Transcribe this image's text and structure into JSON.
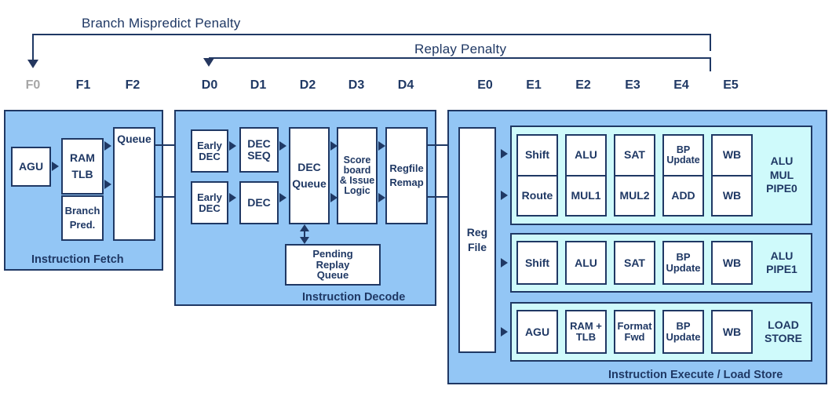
{
  "diagram": {
    "title": "CPU Pipeline Stage Diagram",
    "colors": {
      "outline": "#1F3864",
      "section_fill": "#93C6F5",
      "pipe_fill": "#CFFAFB",
      "unit_fill": "#FFFFFF",
      "dim_label": "#A6A6A6"
    }
  },
  "annotations": [
    {
      "label": "Branch Mispredict Penalty",
      "from_stage": "F0",
      "to_stage": "E5"
    },
    {
      "label": "Replay Penalty",
      "from_stage": "D0",
      "to_stage": "E5"
    }
  ],
  "stages": [
    {
      "id": "F0",
      "label": "F0",
      "dim": true
    },
    {
      "id": "F1",
      "label": "F1",
      "dim": false
    },
    {
      "id": "F2",
      "label": "F2",
      "dim": false
    },
    {
      "id": "D0",
      "label": "D0",
      "dim": false
    },
    {
      "id": "D1",
      "label": "D1",
      "dim": false
    },
    {
      "id": "D2",
      "label": "D2",
      "dim": false
    },
    {
      "id": "D3",
      "label": "D3",
      "dim": false
    },
    {
      "id": "D4",
      "label": "D4",
      "dim": false
    },
    {
      "id": "E0",
      "label": "E0",
      "dim": false
    },
    {
      "id": "E1",
      "label": "E1",
      "dim": false
    },
    {
      "id": "E2",
      "label": "E2",
      "dim": false
    },
    {
      "id": "E3",
      "label": "E3",
      "dim": false
    },
    {
      "id": "E4",
      "label": "E4",
      "dim": false
    },
    {
      "id": "E5",
      "label": "E5",
      "dim": false
    }
  ],
  "sections": {
    "fetch": {
      "title": "Instruction Fetch",
      "units": {
        "agu": "AGU",
        "ram_tlb_line1": "RAM",
        "ram_tlb_line2": "TLB",
        "branch_pred_line1": "Branch",
        "branch_pred_line2": "Pred.",
        "queue": "Queue"
      }
    },
    "decode": {
      "title": "Instruction Decode",
      "units": {
        "early_dec_top_line1": "Early",
        "early_dec_top_line2": "DEC",
        "early_dec_bot_line1": "Early",
        "early_dec_bot_line2": "DEC",
        "dec_seq_line1": "DEC",
        "dec_seq_line2": "SEQ",
        "dec": "DEC",
        "dec_queue_line1": "DEC",
        "dec_queue_line2": "Queue",
        "scoreboard_line1": "Score",
        "scoreboard_line2": "board",
        "scoreboard_line3": "& Issue",
        "scoreboard_line4": "Logic",
        "regfile_remap_line1": "Regfile",
        "regfile_remap_line2": "Remap",
        "pending_replay_line1": "Pending",
        "pending_replay_line2": "Replay",
        "pending_replay_line3": "Queue"
      }
    },
    "execute": {
      "title": "Instruction Execute / Load Store",
      "reg_file_line1": "Reg",
      "reg_file_line2": "File",
      "pipes": [
        {
          "name": "alu-mul-pipe0",
          "label": "ALU\nMUL\nPIPE0",
          "rows": 2,
          "columns": [
            {
              "top": "Shift",
              "bottom": "Route"
            },
            {
              "top": "ALU",
              "bottom": "MUL1"
            },
            {
              "top": "SAT",
              "bottom": "MUL2"
            },
            {
              "top": "BP\nUpdate",
              "bottom": "ADD"
            },
            {
              "top": "WB",
              "bottom": "WB"
            }
          ]
        },
        {
          "name": "alu-pipe1",
          "label": "ALU\nPIPE1",
          "rows": 1,
          "columns": [
            {
              "top": "Shift"
            },
            {
              "top": "ALU"
            },
            {
              "top": "SAT"
            },
            {
              "top": "BP\nUpdate"
            },
            {
              "top": "WB"
            }
          ]
        },
        {
          "name": "load-store",
          "label": "LOAD\nSTORE",
          "rows": 1,
          "columns": [
            {
              "top": "AGU"
            },
            {
              "top": "RAM +\nTLB"
            },
            {
              "top": "Format\nFwd"
            },
            {
              "top": "BP\nUpdate"
            },
            {
              "top": "WB"
            }
          ]
        }
      ]
    }
  }
}
